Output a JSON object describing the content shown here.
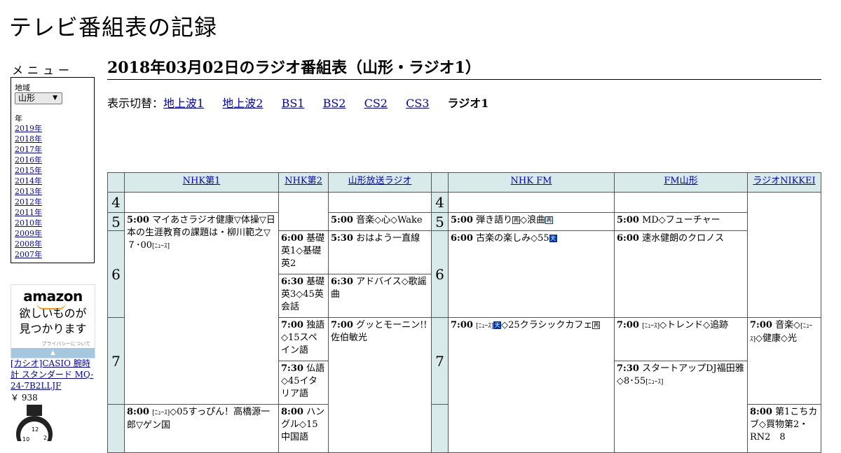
{
  "site": {
    "title": "テレビ番組表の記録"
  },
  "menu": {
    "title": "メニュー",
    "region_label": "地域",
    "region_value": "山形",
    "year_label": "年",
    "years": [
      "2019年",
      "2018年",
      "2017年",
      "2016年",
      "2015年",
      "2014年",
      "2013年",
      "2012年",
      "2011年",
      "2010年",
      "2009年",
      "2008年",
      "2007年"
    ]
  },
  "ad": {
    "logo": "amazon",
    "copy_line1": "欲しいものが",
    "copy_line2": "見つかります",
    "privacy": "プライバシーについて",
    "product": "[カシオ]CASIO 腕時計 スタンダード MQ-24-7B2LLJF",
    "price": "￥ 938"
  },
  "page": {
    "title": "2018年03月02日のラジオ番組表（山形・ラジオ1）",
    "switch_label": "表示切替：",
    "switch_links": [
      "地上波1",
      "地上波2",
      "BS1",
      "BS2",
      "CS2",
      "CS3"
    ],
    "switch_current": "ラジオ1"
  },
  "grid": {
    "channels": [
      "NHK第1",
      "NHK第2",
      "山形放送ラジオ",
      "NHK FM",
      "FM山形",
      "ラジオNIKKEI"
    ],
    "hours": [
      "4",
      "5",
      "6",
      "7",
      "8"
    ],
    "programs": {
      "nhk1_0500": {
        "time": "5:00",
        "title": "マイあさラジオ健康▽体操▽日本の生涯教育の課題は・柳川範之▽７･00",
        "tag": "[ﾆｭｰｽ]"
      },
      "nhk1_0800": {
        "time": "8:00",
        "tag": "[ﾆｭｰｽ]",
        "title": "◇05すっぴん！高橋源一郎▽ゲン国"
      },
      "nhk2_0600": {
        "time": "6:00",
        "title": "基礎英1◇基礎英2"
      },
      "nhk2_0630": {
        "time": "6:30",
        "title": "基礎英3◇45英会話"
      },
      "nhk2_0700": {
        "time": "7:00",
        "title": "独語◇15スペイン語"
      },
      "nhk2_0730": {
        "time": "7:30",
        "title": "仏語◇45イタリア語"
      },
      "nhk2_0800": {
        "time": "8:00",
        "title": "ハングル◇15中国語"
      },
      "ybc_0500": {
        "time": "5:00",
        "title": "音楽◇心◇Wake"
      },
      "ybc_0530": {
        "time": "5:30",
        "title": "おはよう一直線"
      },
      "ybc_0630": {
        "time": "6:30",
        "title": "アドバイス◇歌謡曲"
      },
      "ybc_0700": {
        "time": "7:00",
        "title": "グッとモーニン!!　佐伯敏光"
      },
      "fm_0500": {
        "time": "5:00",
        "title": "弾き語り",
        "mid": "◇浪曲"
      },
      "fm_0600": {
        "time": "6:00",
        "title": "古楽の楽しみ◇55"
      },
      "fm_0700": {
        "time": "7:00",
        "tag": "[ﾆｭｰｽ]",
        "title": "◇25クラシックカフェ"
      },
      "fmy_0500": {
        "time": "5:00",
        "title": "MD◇フューチャー"
      },
      "fmy_0600": {
        "time": "6:00",
        "title": "速水健朗のクロノス"
      },
      "fmy_0700": {
        "time": "7:00",
        "tag": "[ﾆｭｰｽ]",
        "title": "◇トレンド◇追跡"
      },
      "fmy_0730": {
        "time": "7:30",
        "title": "スタートアップDJ福田雅◇8･55",
        "tag2": "[ﾆｭｰｽ]"
      },
      "nikkei_0700": {
        "time": "7:00",
        "title": "音楽◇",
        "tag": "[ﾆｭｰｽ]",
        "title2": "◇健康◇光"
      },
      "nikkei_0800": {
        "time": "8:00",
        "title": "第1こちカブ◇買物第2・RN2　8"
      }
    },
    "icons": {
      "stereo": "再",
      "news": "天"
    }
  }
}
